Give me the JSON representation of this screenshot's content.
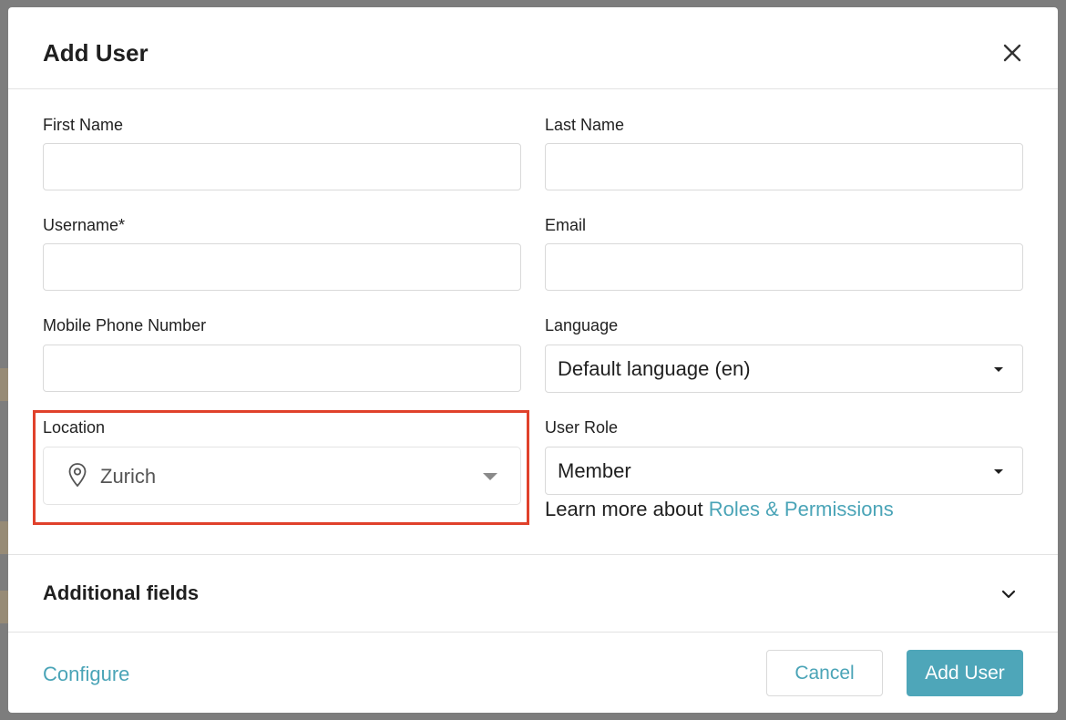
{
  "dialog": {
    "title": "Add User",
    "close_icon": "close-icon"
  },
  "form": {
    "first_name": {
      "label": "First Name",
      "value": "",
      "placeholder": ""
    },
    "last_name": {
      "label": "Last Name",
      "value": "",
      "placeholder": ""
    },
    "username": {
      "label": "Username*",
      "value": "",
      "placeholder": ""
    },
    "email": {
      "label": "Email",
      "value": "",
      "placeholder": ""
    },
    "mobile_phone": {
      "label": "Mobile Phone Number",
      "value": "",
      "placeholder": ""
    },
    "language": {
      "label": "Language",
      "selected": "Default language (en)"
    },
    "location": {
      "label": "Location",
      "selected": "Zurich",
      "icon": "map-pin-icon"
    },
    "user_role": {
      "label": "User Role",
      "selected": "Member"
    },
    "roles_help": {
      "prefix": "Learn more about ",
      "link": "Roles & Permissions"
    }
  },
  "additional_fields": {
    "title": "Additional fields",
    "icon": "chevron-down-icon"
  },
  "footer": {
    "configure_link": "Configure",
    "cancel_label": "Cancel",
    "add_label": "Add User"
  },
  "colors": {
    "accent": "#4ea6b9",
    "highlight": "#e0412b",
    "backdrop": "#7d7d7d"
  }
}
